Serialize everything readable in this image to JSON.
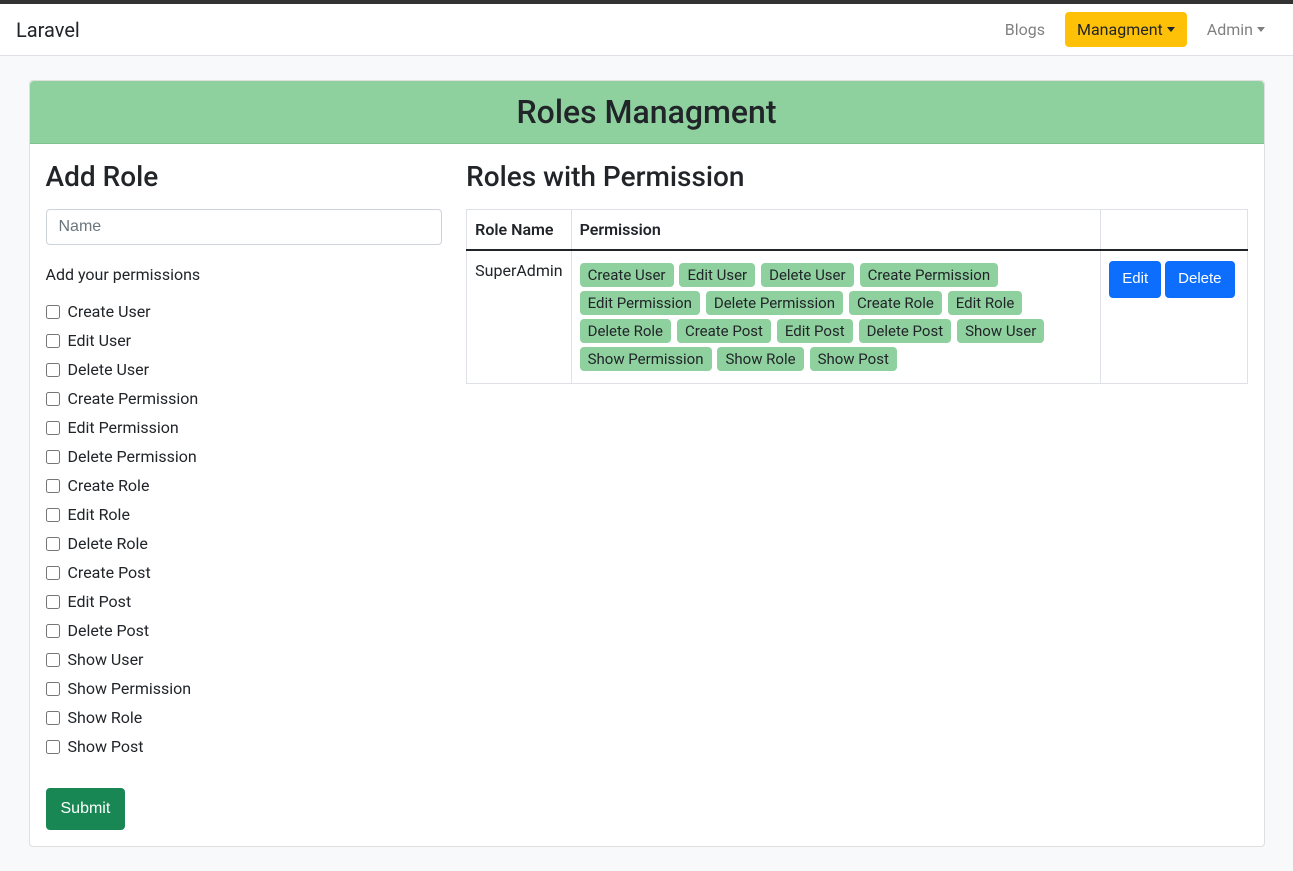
{
  "navbar": {
    "brand": "Laravel",
    "links": {
      "blogs": "Blogs",
      "management": "Managment",
      "admin": "Admin"
    }
  },
  "header": {
    "title": "Roles Managment"
  },
  "addRole": {
    "title": "Add Role",
    "namePlaceholder": "Name",
    "permLabel": "Add your permissions",
    "submit": "Submit",
    "permissions": [
      "Create User",
      "Edit User",
      "Delete User",
      "Create Permission",
      "Edit Permission",
      "Delete Permission",
      "Create Role",
      "Edit Role",
      "Delete Role",
      "Create Post",
      "Edit Post",
      "Delete Post",
      "Show User",
      "Show Permission",
      "Show Role",
      "Show Post"
    ]
  },
  "rolesTable": {
    "title": "Roles with Permission",
    "headers": {
      "roleName": "Role Name",
      "permission": "Permission"
    },
    "rows": [
      {
        "name": "SuperAdmin",
        "permissions": [
          "Create User",
          "Edit User",
          "Delete User",
          "Create Permission",
          "Edit Permission",
          "Delete Permission",
          "Create Role",
          "Edit Role",
          "Delete Role",
          "Create Post",
          "Edit Post",
          "Delete Post",
          "Show User",
          "Show Permission",
          "Show Role",
          "Show Post"
        ]
      }
    ],
    "actions": {
      "edit": "Edit",
      "delete": "Delete"
    }
  }
}
